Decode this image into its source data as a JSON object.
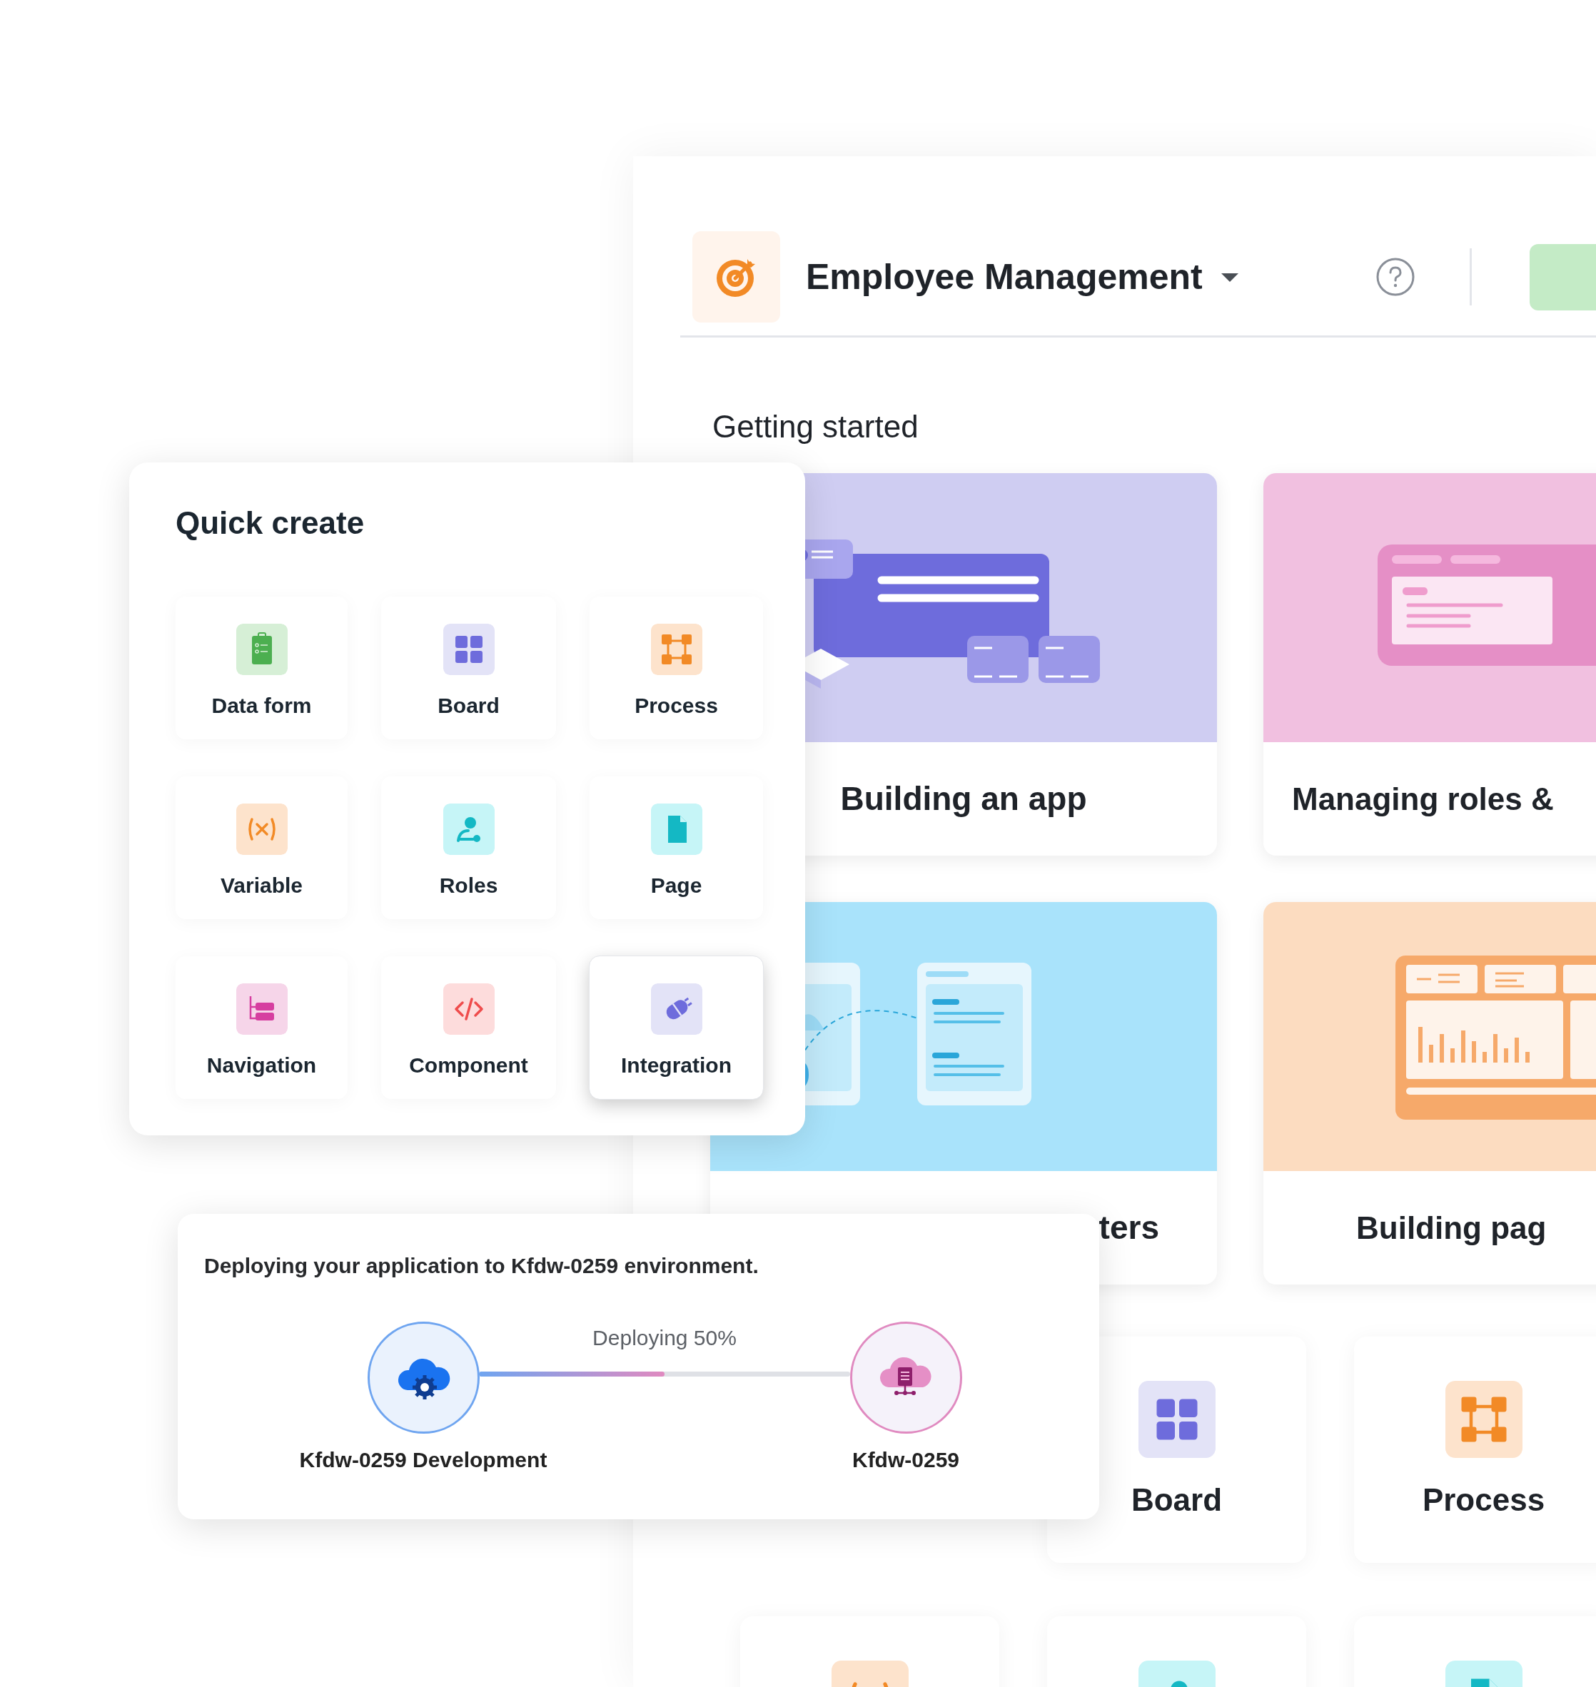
{
  "app_header": {
    "title": "Employee Management"
  },
  "getting_started": {
    "heading": "Getting started",
    "cards": [
      {
        "title": "Building an app",
        "kind": "app"
      },
      {
        "title": "Managing roles &",
        "kind": "roles"
      },
      {
        "title": "ters",
        "kind": "params"
      },
      {
        "title": "Building pag",
        "kind": "pages"
      }
    ]
  },
  "create_tiles": [
    {
      "label": "Board",
      "kind": "board"
    },
    {
      "label": "Process",
      "kind": "process"
    },
    {
      "kind": "variable"
    },
    {
      "kind": "roles"
    },
    {
      "kind": "page"
    }
  ],
  "quick_create": {
    "title": "Quick create",
    "items": [
      {
        "label": "Data form",
        "kind": "form",
        "selected": false
      },
      {
        "label": "Board",
        "kind": "board",
        "selected": false
      },
      {
        "label": "Process",
        "kind": "process",
        "selected": false
      },
      {
        "label": "Variable",
        "kind": "variable",
        "selected": false
      },
      {
        "label": "Roles",
        "kind": "roles",
        "selected": false
      },
      {
        "label": "Page",
        "kind": "page",
        "selected": false
      },
      {
        "label": "Navigation",
        "kind": "navigation",
        "selected": false
      },
      {
        "label": "Component",
        "kind": "component",
        "selected": false
      },
      {
        "label": "Integration",
        "kind": "integration",
        "selected": true
      }
    ]
  },
  "deployment": {
    "message": "Deploying your application to Kfdw-0259 environment.",
    "status": "Deploying 50%",
    "level": 0.5,
    "source": "Kfdw-0259 Development",
    "target": "Kfdw-0259"
  }
}
